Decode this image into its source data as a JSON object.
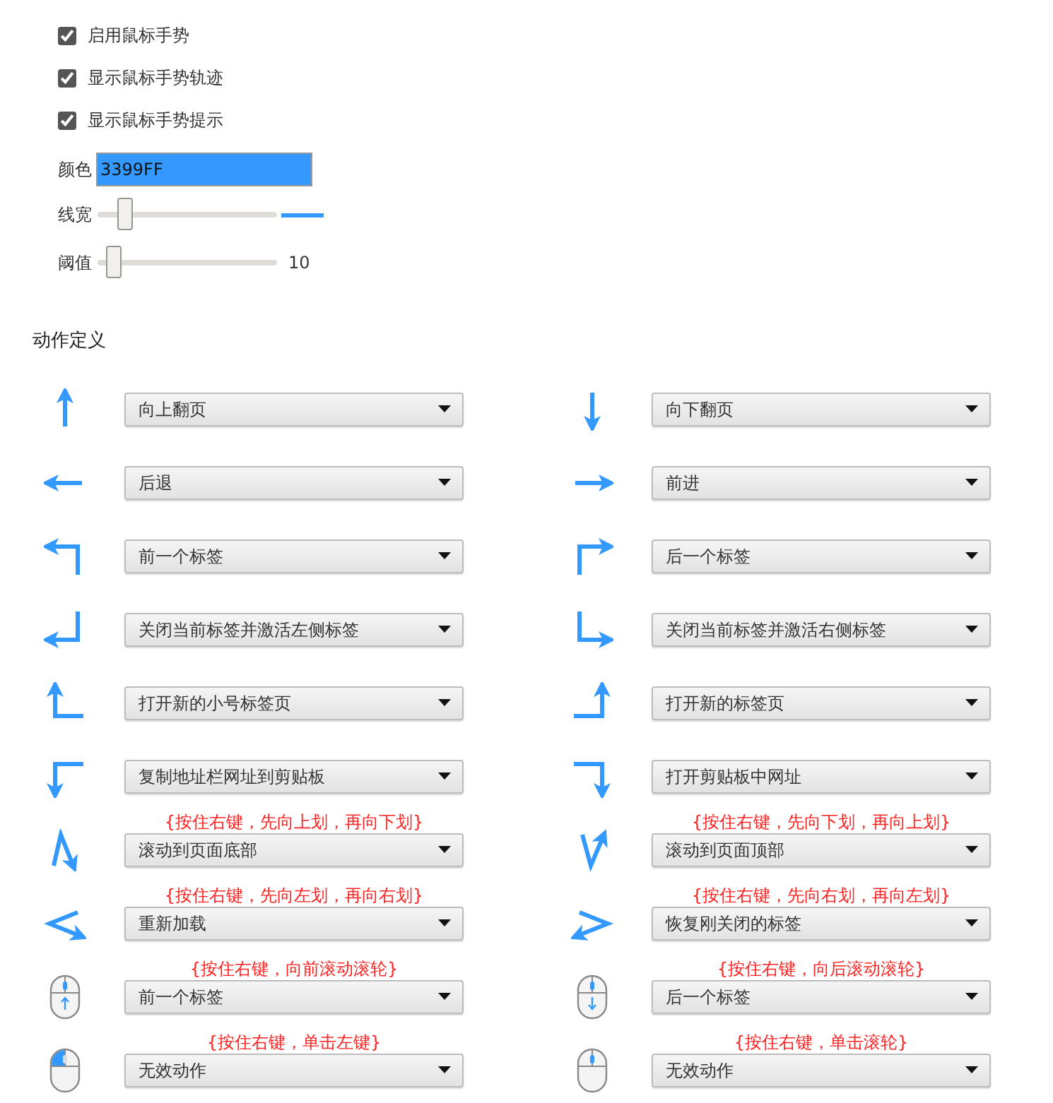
{
  "options": [
    {
      "label": "启用鼠标手势",
      "checked": true
    },
    {
      "label": "显示鼠标手势轨迹",
      "checked": true
    },
    {
      "label": "显示鼠标手势提示",
      "checked": true
    }
  ],
  "color": {
    "label": "颜色",
    "value": "3399FF"
  },
  "sliders": [
    {
      "label": "线宽",
      "level": 0.15,
      "kind": "preview"
    },
    {
      "label": "阈值",
      "level": 0.09,
      "kind": "reading",
      "reading": "10"
    }
  ],
  "section_title": "动作定义",
  "gestures": [
    {
      "kind": "up",
      "action": "向上翻页"
    },
    {
      "kind": "down",
      "action": "向下翻页"
    },
    {
      "kind": "left",
      "action": "后退"
    },
    {
      "kind": "right",
      "action": "前进"
    },
    {
      "kind": "up-left",
      "action": "前一个标签"
    },
    {
      "kind": "up-right",
      "action": "后一个标签"
    },
    {
      "kind": "down-left",
      "action": "关闭当前标签并激活左侧标签"
    },
    {
      "kind": "down-right",
      "action": "关闭当前标签并激活右侧标签"
    },
    {
      "kind": "left-up",
      "action": "打开新的小号标签页"
    },
    {
      "kind": "right-up",
      "action": "打开新的标签页"
    },
    {
      "kind": "left-down",
      "action": "复制地址栏网址到剪贴板"
    },
    {
      "kind": "right-down",
      "action": "打开剪贴板中网址"
    },
    {
      "kind": "up-down",
      "action": "滚动到页面底部",
      "hint": "{按住右键，先向上划，再向下划}"
    },
    {
      "kind": "down-up",
      "action": "滚动到页面顶部",
      "hint": "{按住右键，先向下划，再向上划}"
    },
    {
      "kind": "left-right",
      "action": "重新加载",
      "hint": "{按住右键，先向左划，再向右划}"
    },
    {
      "kind": "right-left",
      "action": "恢复刚关闭的标签",
      "hint": "{按住右键，先向右划，再向左划}"
    },
    {
      "kind": "wheel-up",
      "action": "前一个标签",
      "hint": "{按住右键，向前滚动滚轮}"
    },
    {
      "kind": "wheel-down",
      "action": "后一个标签",
      "hint": "{按住右键，向后滚动滚轮}"
    },
    {
      "kind": "left-click",
      "action": "无效动作",
      "hint": "{按住右键，单击左键}"
    },
    {
      "kind": "wheel-click",
      "action": "无效动作",
      "hint": "{按住右键，单击滚轮}"
    }
  ]
}
